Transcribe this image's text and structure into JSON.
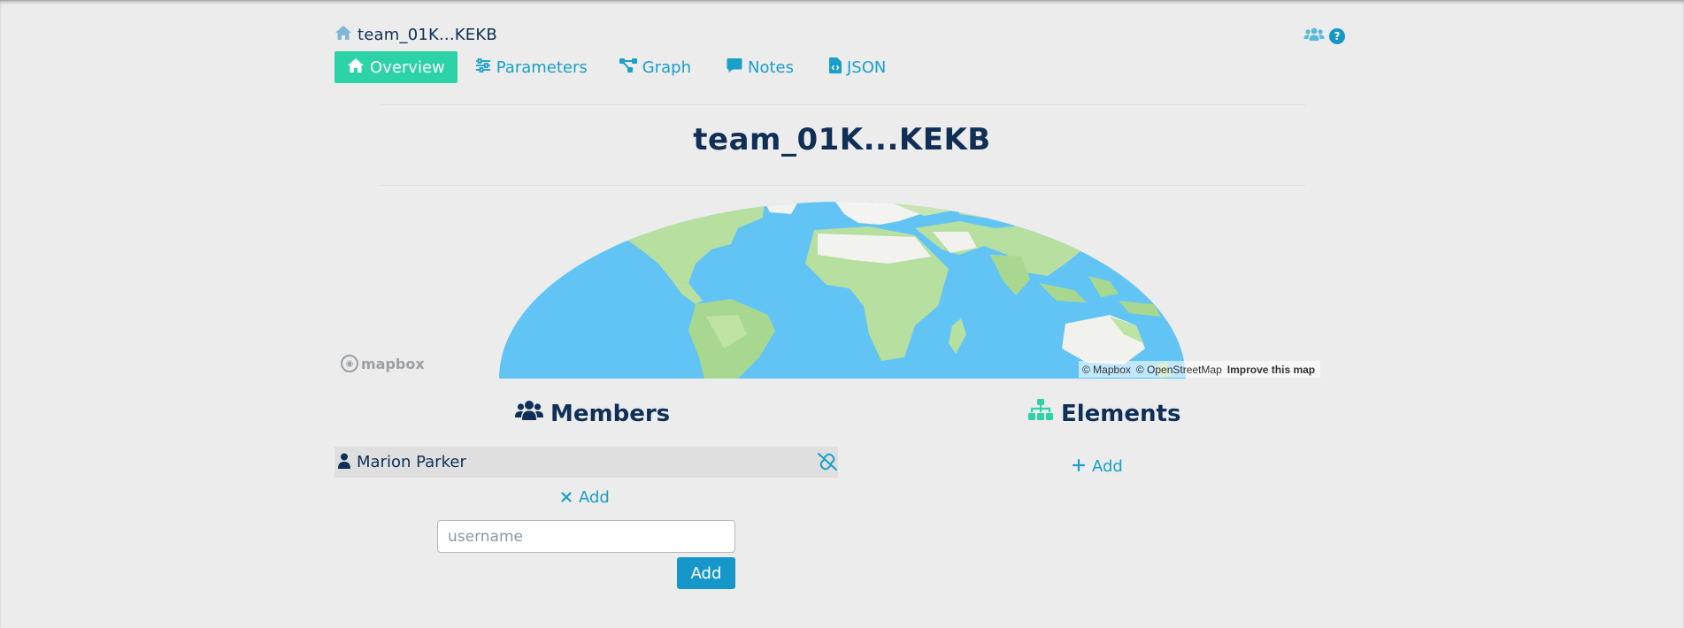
{
  "breadcrumb": {
    "label": "team_01K...KEKB",
    "icon": "home-icon"
  },
  "header_icons": {
    "team": "users-icon",
    "help_glyph": "?"
  },
  "tabs": [
    {
      "label": "Overview",
      "icon": "home-icon",
      "active": true
    },
    {
      "label": "Parameters",
      "icon": "sliders-icon",
      "active": false
    },
    {
      "label": "Graph",
      "icon": "graph-icon",
      "active": false
    },
    {
      "label": "Notes",
      "icon": "comment-icon",
      "active": false
    },
    {
      "label": "JSON",
      "icon": "file-code-icon",
      "active": false
    }
  ],
  "page_title": "team_01K...KEKB",
  "map": {
    "logo_text": "mapbox",
    "attribution": [
      "© Mapbox",
      "© OpenStreetMap",
      "Improve this map"
    ]
  },
  "members": {
    "title": "Members",
    "items": [
      {
        "name": "Marion Parker"
      }
    ],
    "add_label": "Add",
    "input_placeholder": "username",
    "submit_label": "Add"
  },
  "elements": {
    "title": "Elements",
    "add_label": "Add"
  },
  "colors": {
    "navy": "#0f2f57",
    "accent": "#1a9fc7",
    "active_tab": "#2cd3a6",
    "button": "#1598c9",
    "background": "#ececec"
  }
}
